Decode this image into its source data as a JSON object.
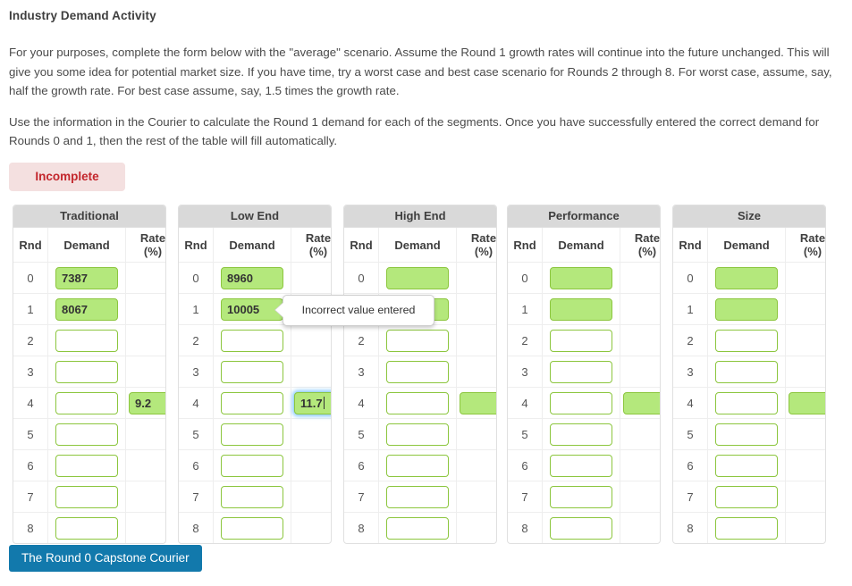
{
  "page": {
    "title": "Industry Demand Activity",
    "paragraphs": [
      "For your purposes, complete the form below with the \"average\" scenario. Assume the Round 1 growth rates will continue into the future unchanged. This will give you some idea for potential market size. If you have time, try a worst case and best case scenario for Rounds 2 through 8. For worst case, assume, say, half the growth rate. For best case assume, say, 1.5 times the growth rate.",
      "Use the information in the Courier to calculate the Round 1 demand for each of the segments. Once you have successfully entered the correct demand for Rounds 0 and 1, then the rest of the table will fill automatically."
    ]
  },
  "status": {
    "label": "Incomplete",
    "bg_color": "#f4e0e0",
    "text_color": "#c3262c"
  },
  "table_columns": {
    "rnd": "Rnd",
    "demand": "Demand",
    "rate_line1": "Rate",
    "rate_line2": "(%)"
  },
  "rounds": [
    "0",
    "1",
    "2",
    "3",
    "4",
    "5",
    "6",
    "7",
    "8"
  ],
  "segments": [
    {
      "name": "Traditional",
      "demand": [
        {
          "value": "7387",
          "state": "filled"
        },
        {
          "value": "8067",
          "state": "filled"
        },
        {
          "value": "",
          "state": "empty"
        },
        {
          "value": "",
          "state": "empty"
        },
        {
          "value": "",
          "state": "empty"
        },
        {
          "value": "",
          "state": "empty"
        },
        {
          "value": "",
          "state": "empty"
        },
        {
          "value": "",
          "state": "empty"
        },
        {
          "value": "",
          "state": "empty"
        }
      ],
      "rate": [
        {
          "value": "",
          "state": "none"
        },
        {
          "value": "",
          "state": "none"
        },
        {
          "value": "",
          "state": "none"
        },
        {
          "value": "",
          "state": "none"
        },
        {
          "value": "9.2",
          "state": "filled"
        },
        {
          "value": "",
          "state": "none"
        },
        {
          "value": "",
          "state": "none"
        },
        {
          "value": "",
          "state": "none"
        },
        {
          "value": "",
          "state": "none"
        }
      ]
    },
    {
      "name": "Low End",
      "demand": [
        {
          "value": "8960",
          "state": "filled"
        },
        {
          "value": "10005",
          "state": "filled"
        },
        {
          "value": "",
          "state": "empty"
        },
        {
          "value": "",
          "state": "empty"
        },
        {
          "value": "",
          "state": "empty"
        },
        {
          "value": "",
          "state": "empty"
        },
        {
          "value": "",
          "state": "empty"
        },
        {
          "value": "",
          "state": "empty"
        },
        {
          "value": "",
          "state": "empty"
        }
      ],
      "rate": [
        {
          "value": "",
          "state": "none"
        },
        {
          "value": "",
          "state": "none"
        },
        {
          "value": "",
          "state": "none"
        },
        {
          "value": "",
          "state": "none"
        },
        {
          "value": "11.7",
          "state": "focused"
        },
        {
          "value": "",
          "state": "none"
        },
        {
          "value": "",
          "state": "none"
        },
        {
          "value": "",
          "state": "none"
        },
        {
          "value": "",
          "state": "none"
        }
      ]
    },
    {
      "name": "High End",
      "demand": [
        {
          "value": "",
          "state": "filled"
        },
        {
          "value": "",
          "state": "filled"
        },
        {
          "value": "",
          "state": "empty"
        },
        {
          "value": "",
          "state": "empty"
        },
        {
          "value": "",
          "state": "empty"
        },
        {
          "value": "",
          "state": "empty"
        },
        {
          "value": "",
          "state": "empty"
        },
        {
          "value": "",
          "state": "empty"
        },
        {
          "value": "",
          "state": "empty"
        }
      ],
      "rate": [
        {
          "value": "",
          "state": "none"
        },
        {
          "value": "",
          "state": "none"
        },
        {
          "value": "",
          "state": "none"
        },
        {
          "value": "",
          "state": "none"
        },
        {
          "value": "",
          "state": "filled"
        },
        {
          "value": "",
          "state": "none"
        },
        {
          "value": "",
          "state": "none"
        },
        {
          "value": "",
          "state": "none"
        },
        {
          "value": "",
          "state": "none"
        }
      ]
    },
    {
      "name": "Performance",
      "demand": [
        {
          "value": "",
          "state": "filled"
        },
        {
          "value": "",
          "state": "filled"
        },
        {
          "value": "",
          "state": "empty"
        },
        {
          "value": "",
          "state": "empty"
        },
        {
          "value": "",
          "state": "empty"
        },
        {
          "value": "",
          "state": "empty"
        },
        {
          "value": "",
          "state": "empty"
        },
        {
          "value": "",
          "state": "empty"
        },
        {
          "value": "",
          "state": "empty"
        }
      ],
      "rate": [
        {
          "value": "",
          "state": "none"
        },
        {
          "value": "",
          "state": "none"
        },
        {
          "value": "",
          "state": "none"
        },
        {
          "value": "",
          "state": "none"
        },
        {
          "value": "",
          "state": "filled"
        },
        {
          "value": "",
          "state": "none"
        },
        {
          "value": "",
          "state": "none"
        },
        {
          "value": "",
          "state": "none"
        },
        {
          "value": "",
          "state": "none"
        }
      ]
    },
    {
      "name": "Size",
      "demand": [
        {
          "value": "",
          "state": "filled"
        },
        {
          "value": "",
          "state": "filled"
        },
        {
          "value": "",
          "state": "empty"
        },
        {
          "value": "",
          "state": "empty"
        },
        {
          "value": "",
          "state": "empty"
        },
        {
          "value": "",
          "state": "empty"
        },
        {
          "value": "",
          "state": "empty"
        },
        {
          "value": "",
          "state": "empty"
        },
        {
          "value": "",
          "state": "empty"
        }
      ],
      "rate": [
        {
          "value": "",
          "state": "none"
        },
        {
          "value": "",
          "state": "none"
        },
        {
          "value": "",
          "state": "none"
        },
        {
          "value": "",
          "state": "none"
        },
        {
          "value": "",
          "state": "filled"
        },
        {
          "value": "",
          "state": "none"
        },
        {
          "value": "",
          "state": "none"
        },
        {
          "value": "",
          "state": "none"
        },
        {
          "value": "",
          "state": "none"
        }
      ]
    }
  ],
  "tooltip": {
    "text": "Incorrect value entered"
  },
  "courier_button": {
    "label": "The Round 0 Capstone Courier",
    "bg_color": "#1279ac"
  }
}
